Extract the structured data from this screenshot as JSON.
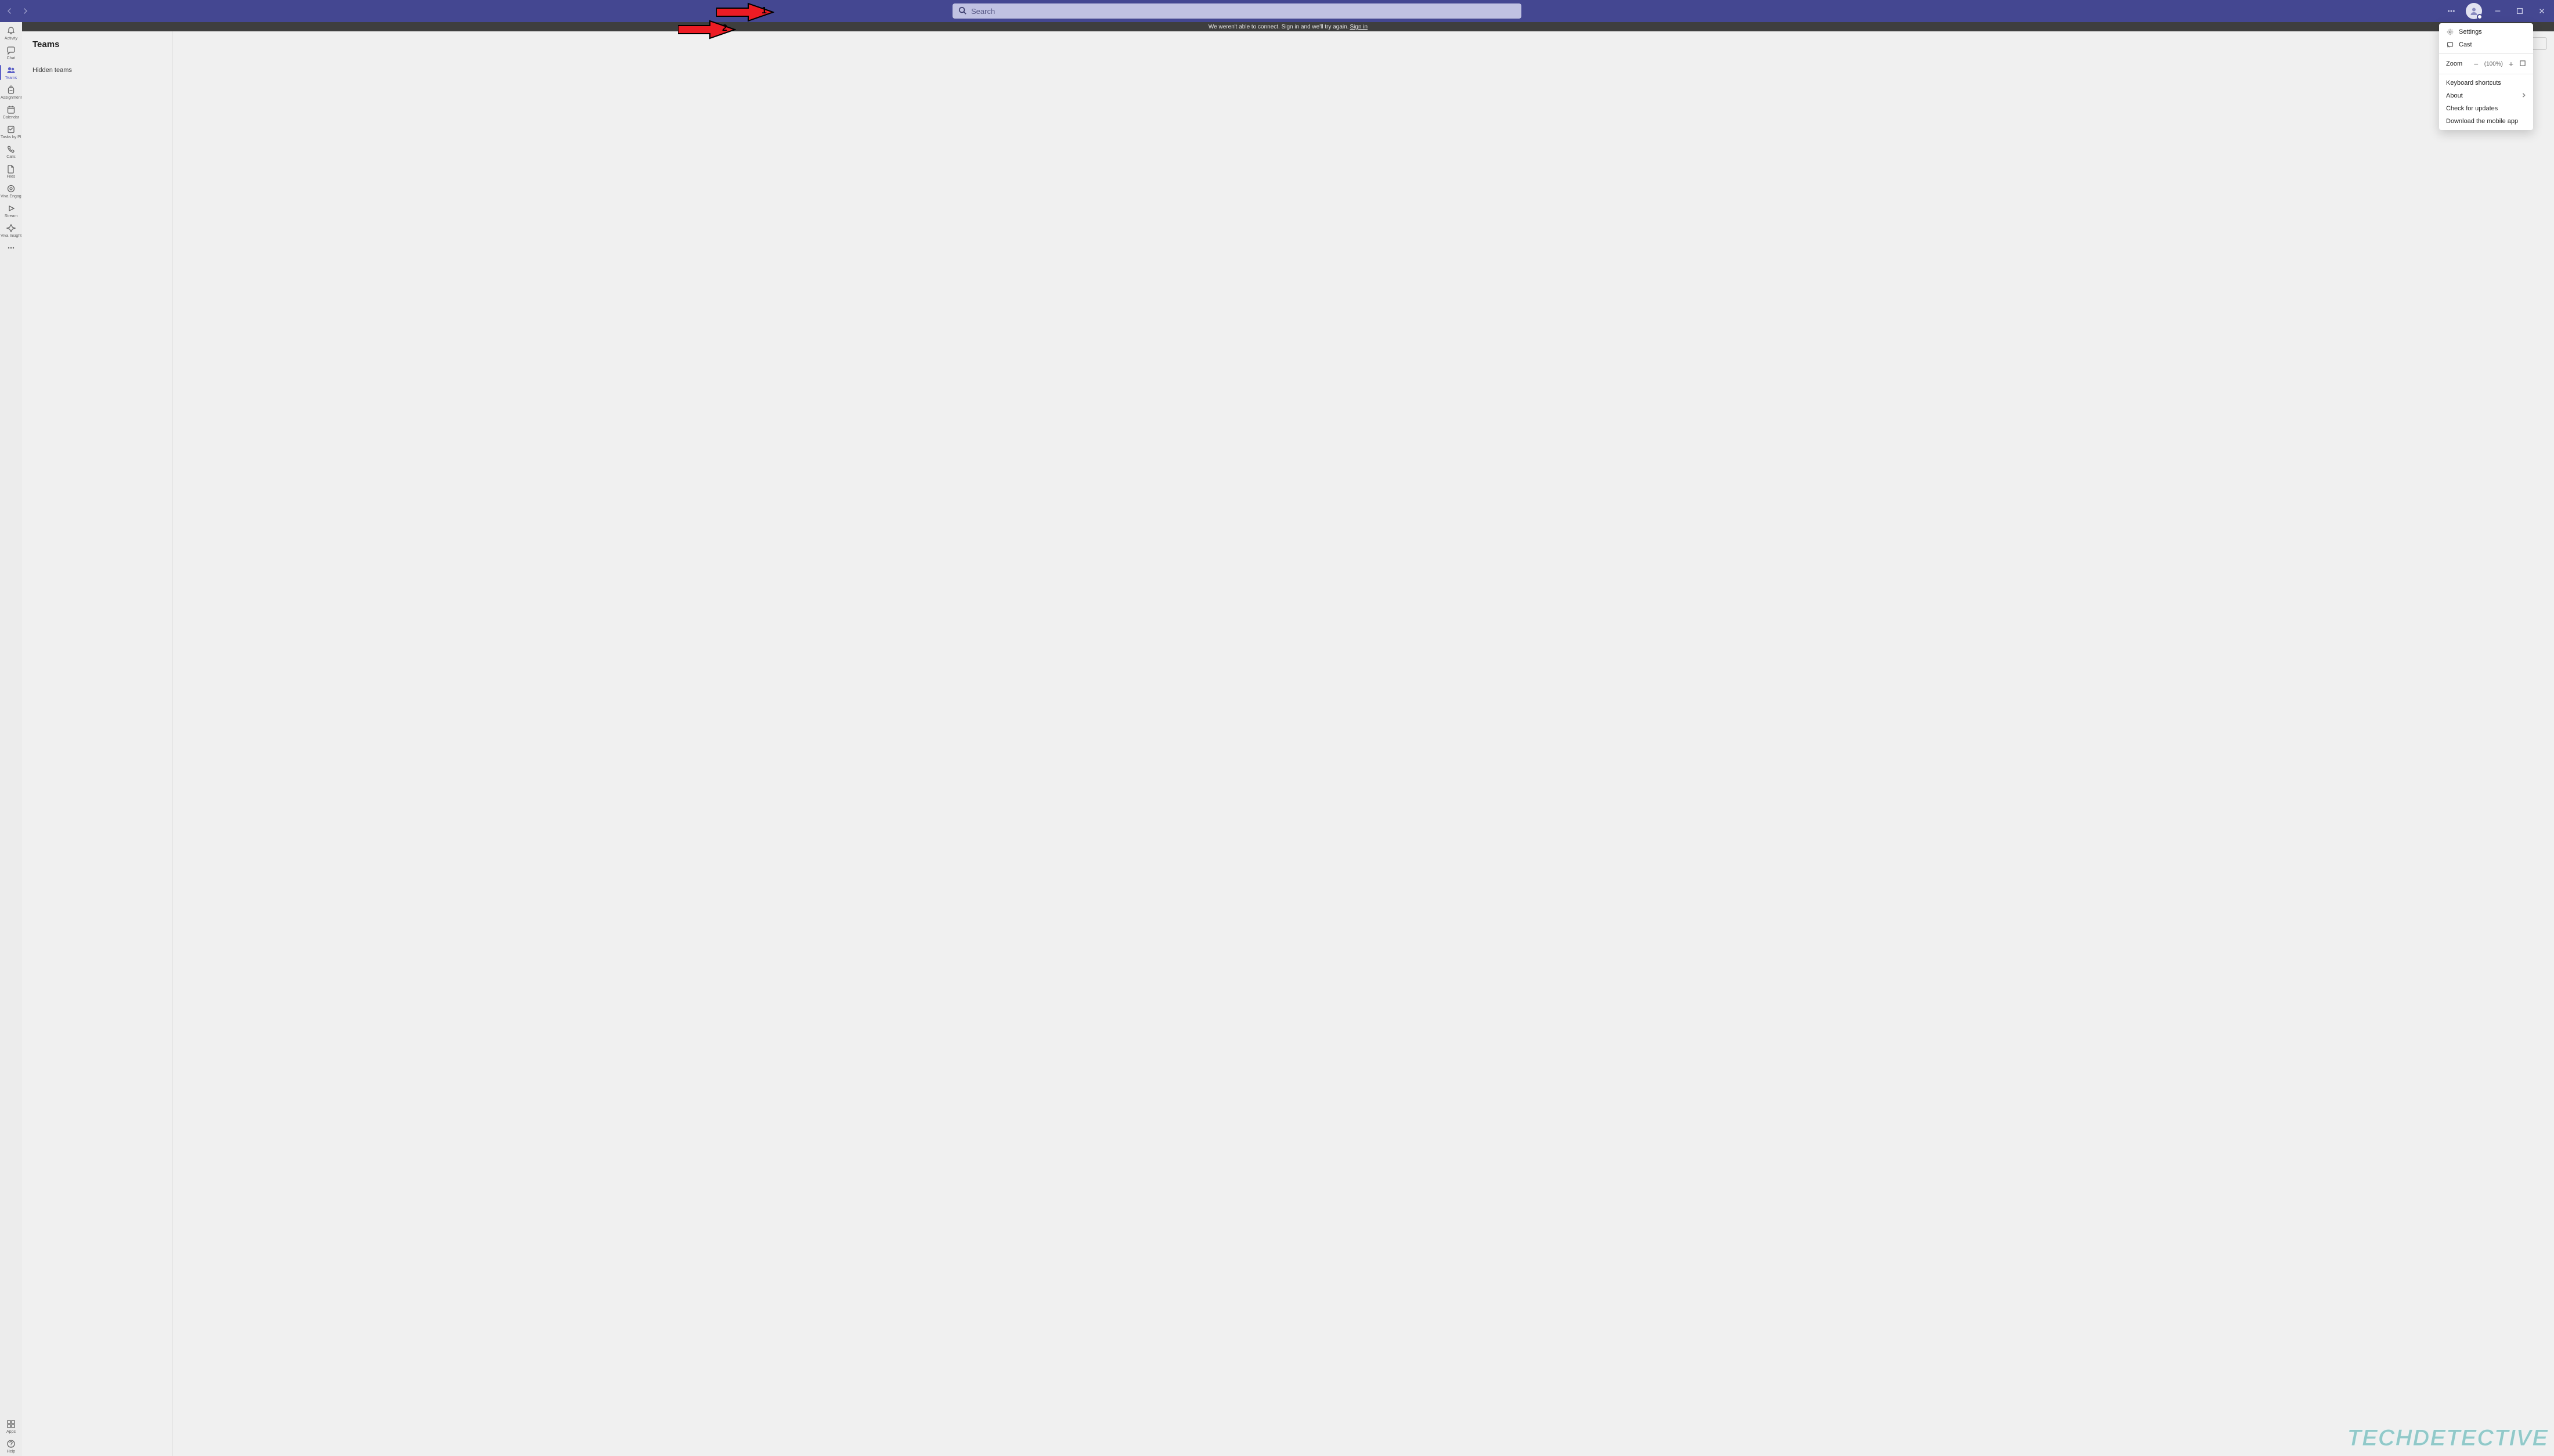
{
  "colors": {
    "titlebar": "#444791",
    "accent": "#5b5fc7",
    "arrow_fill": "#ec1c24",
    "arrow_stroke": "#000000"
  },
  "titlebar": {
    "search_placeholder": "Search"
  },
  "banner": {
    "text_before": "We weren't able to connect. Sign in and we'll try again. ",
    "signin_label": "Sign in"
  },
  "rail": {
    "items": [
      {
        "id": "activity",
        "label": "Activity",
        "icon": "bell"
      },
      {
        "id": "chat",
        "label": "Chat",
        "icon": "chat"
      },
      {
        "id": "teams",
        "label": "Teams",
        "icon": "people",
        "active": true
      },
      {
        "id": "assignments",
        "label": "Assignments",
        "icon": "backpack"
      },
      {
        "id": "calendar",
        "label": "Calendar",
        "icon": "calendar"
      },
      {
        "id": "tasks",
        "label": "Tasks by Pl…",
        "icon": "tasks"
      },
      {
        "id": "calls",
        "label": "Calls",
        "icon": "phone"
      },
      {
        "id": "files",
        "label": "Files",
        "icon": "file"
      },
      {
        "id": "viva-engage",
        "label": "Viva Engage",
        "icon": "engage"
      },
      {
        "id": "stream",
        "label": "Stream",
        "icon": "stream"
      },
      {
        "id": "viva-insights",
        "label": "Viva Insights",
        "icon": "insights"
      }
    ],
    "bottom": [
      {
        "id": "apps",
        "label": "Apps",
        "icon": "apps"
      },
      {
        "id": "help",
        "label": "Help",
        "icon": "help"
      }
    ]
  },
  "teams_pane": {
    "title": "Teams",
    "hidden_label": "Hidden teams"
  },
  "dropdown": {
    "settings_label": "Settings",
    "cast_label": "Cast",
    "zoom_label": "Zoom",
    "zoom_value": "(100%)",
    "keyboard_label": "Keyboard shortcuts",
    "about_label": "About",
    "check_updates_label": "Check for updates",
    "download_app_label": "Download the mobile app"
  },
  "annotations": {
    "arrow1_num": "1",
    "arrow2_num": "2"
  },
  "watermark": "TECHDETECTIVE"
}
